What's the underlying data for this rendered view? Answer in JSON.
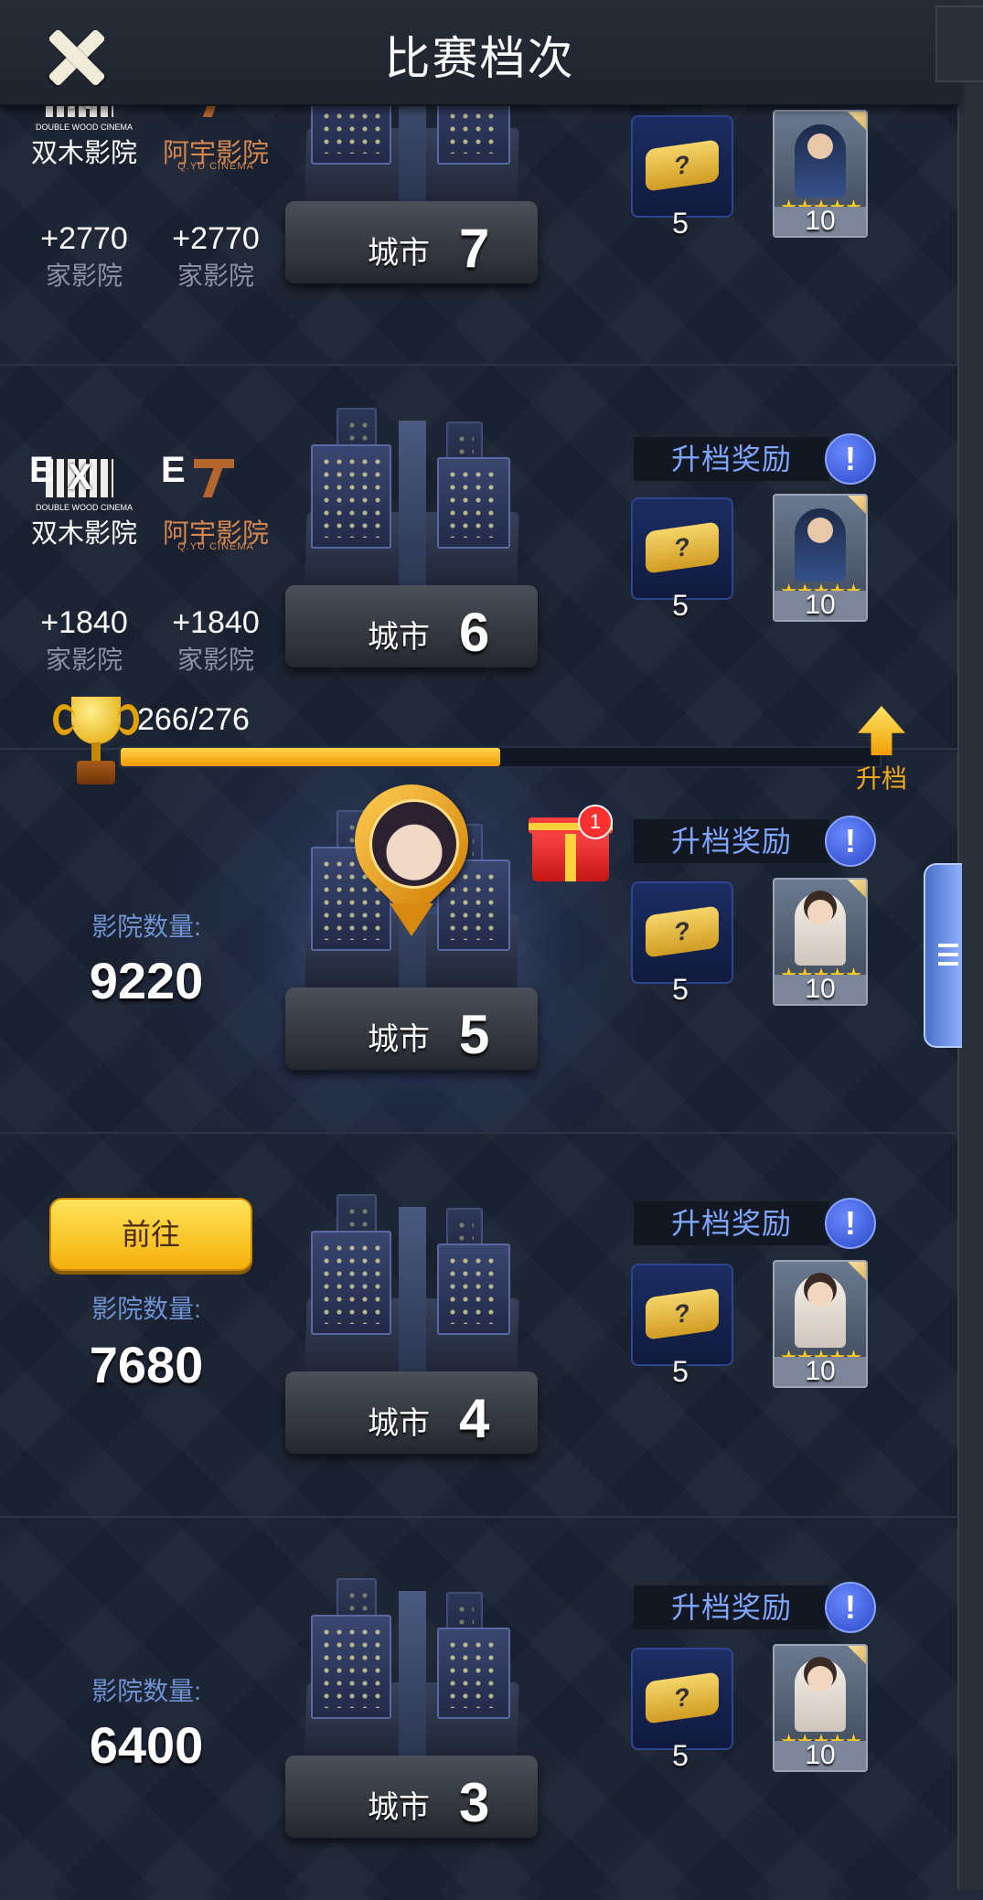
{
  "header": {
    "title": "比赛档次"
  },
  "rows": {
    "city7": {
      "city_label": "城市",
      "city_num": "7",
      "reward_label": "",
      "item_count": "5",
      "card_count": "10",
      "cinemas": [
        {
          "grade": "",
          "name": "双木影院",
          "sub": "DOUBLE WOOD CINEMA",
          "plus": "+2770",
          "unit": "家影院"
        },
        {
          "grade": "",
          "name": "阿宇影院",
          "sub": "Q.YU CINEMA",
          "plus": "+2770",
          "unit": "家影院"
        }
      ]
    },
    "city6": {
      "city_label": "城市",
      "city_num": "6",
      "reward_label": "升档奖励",
      "item_count": "5",
      "card_count": "10",
      "cinemas": [
        {
          "grade": "E",
          "name": "双木影院",
          "sub": "DOUBLE WOOD CINEMA",
          "plus": "+1840",
          "unit": "家影院"
        },
        {
          "grade": "E",
          "name": "阿宇影院",
          "sub": "Q.YU CINEMA",
          "plus": "+1840",
          "unit": "家影院"
        }
      ]
    },
    "city5": {
      "city_label": "城市",
      "city_num": "5",
      "reward_label": "升档奖励",
      "item_count": "5",
      "card_count": "10",
      "count_label": "影院数量:",
      "count_value": "9220"
    },
    "city4": {
      "city_label": "城市",
      "city_num": "4",
      "reward_label": "升档奖励",
      "item_count": "5",
      "card_count": "10",
      "count_label": "影院数量:",
      "count_value": "7680",
      "go_label": "前往"
    },
    "city3": {
      "city_label": "城市",
      "city_num": "3",
      "reward_label": "升档奖励",
      "item_count": "5",
      "card_count": "10",
      "count_label": "影院数量:",
      "count_value": "6400"
    }
  },
  "progress": {
    "text": "266/276",
    "fraction": 0.5,
    "upgrade_label": "升档"
  },
  "gift": {
    "badge": "1"
  },
  "icons": {
    "close": "close-icon",
    "info": "info-icon",
    "trophy": "trophy-icon",
    "upgrade": "upgrade-arrow-icon",
    "gift": "gift-icon",
    "menu": "list-menu-icon"
  },
  "colors": {
    "accent_gold": "#f5b10a",
    "reward_blue": "#7fa6ff",
    "count_blue": "#6f93d2"
  }
}
